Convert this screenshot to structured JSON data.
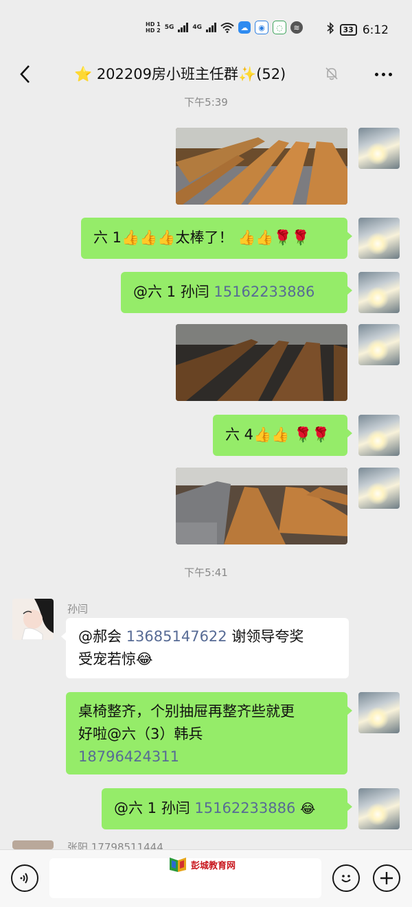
{
  "status_bar": {
    "hd1": "HD 1",
    "hd2": "HD 2",
    "sig1": "5G",
    "sig2": "4G",
    "battery": "33",
    "time": "6:12"
  },
  "header": {
    "title": "⭐ 202209房小班主任群✨(52)"
  },
  "timestamps": [
    "下午5:39",
    "下午5:41"
  ],
  "messages": {
    "m1_text": "六 1👍👍👍太棒了！ 👍👍🌹🌹",
    "m2_prefix": "@六 1 孙闫 ",
    "m2_phone": "15162233886",
    "m3_text": "六 4👍👍 🌹🌹",
    "m4_sender": "孙闫",
    "m4_prefix": "@郝会 ",
    "m4_phone": "13685147622",
    "m4_line1_suffix": " 谢领导夸奖",
    "m4_line2": "受宠若惊😂",
    "m5_line1": "桌椅整齐，个别抽屉再整齐些就更",
    "m5_line2": "好啦@六（3）韩兵",
    "m5_phone": "18796424311",
    "m6_prefix": "@六 1 孙闫 ",
    "m6_phone": "15162233886",
    "m6_emoji": "😂",
    "next_sender": "张阳 17798511444"
  },
  "input_bar": {
    "voice_icon": "voice-icon",
    "emoji_icon": "emoji-icon",
    "plus_icon": "plus-icon"
  },
  "watermark": "彭城教育网",
  "colors": {
    "my_bubble": "#95ec69",
    "their_bubble": "#ffffff",
    "link_phone": "#576b95",
    "background": "#ededed"
  }
}
